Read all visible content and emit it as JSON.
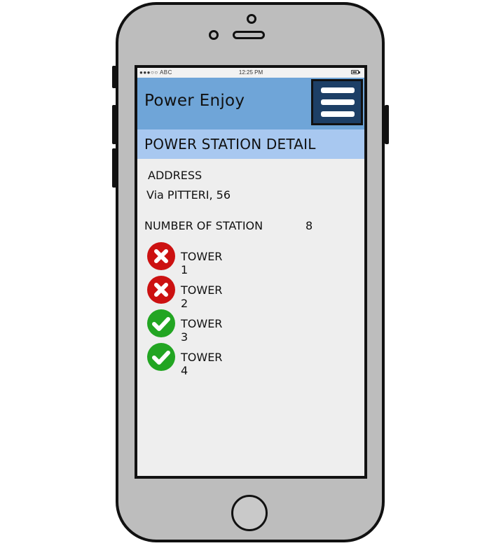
{
  "status_bar": {
    "carrier": "●●●○○ ABC",
    "time": "12:25 PM"
  },
  "app": {
    "title": "Power Enjoy",
    "menu_icon": "hamburger-menu-icon"
  },
  "page": {
    "header": "POWER STATION DETAIL"
  },
  "details": {
    "address_label": "ADDRESS",
    "address_value": "Via PITTERI, 56",
    "stations_label": "NUMBER OF STATION",
    "stations_value": "8"
  },
  "towers": [
    {
      "name": "TOWER 1",
      "status": "unavailable",
      "icon": "x-circle-icon",
      "color": "#cc1111"
    },
    {
      "name": "TOWER 2",
      "status": "unavailable",
      "icon": "x-circle-icon",
      "color": "#cc1111"
    },
    {
      "name": "TOWER 3",
      "status": "available",
      "icon": "check-circle-icon",
      "color": "#22a522"
    },
    {
      "name": "TOWER 4",
      "status": "available",
      "icon": "check-circle-icon",
      "color": "#22a522"
    }
  ],
  "colors": {
    "appbar": "#6fa5d8",
    "subheader": "#a8c8f0",
    "menu_button": "#1d3f66",
    "screen_bg": "#eeeeee",
    "phone_body": "#bdbdbd"
  }
}
